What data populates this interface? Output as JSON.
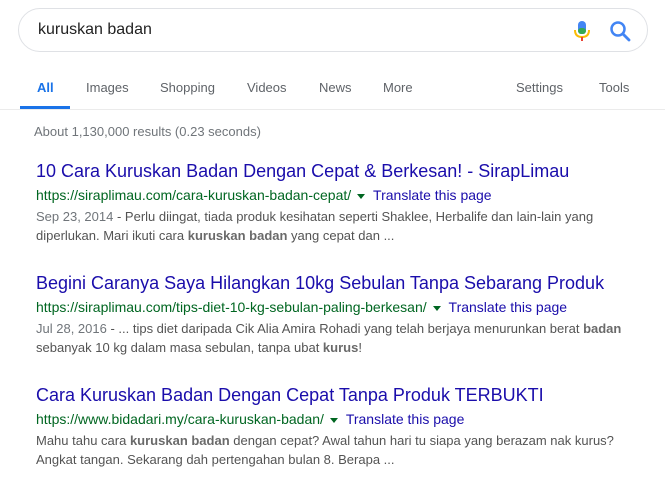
{
  "search": {
    "query": "kuruskan badan"
  },
  "tabs": [
    {
      "label": "All"
    },
    {
      "label": "Images"
    },
    {
      "label": "Shopping"
    },
    {
      "label": "Videos"
    },
    {
      "label": "News"
    },
    {
      "label": "More"
    },
    {
      "label": "Settings"
    },
    {
      "label": "Tools"
    }
  ],
  "stats": "About 1,130,000 results (0.23 seconds)",
  "results": [
    {
      "title": "10 Cara Kuruskan Badan Dengan Cepat & Berkesan! - SirapLimau",
      "url": "https://siraplimau.com/cara-kuruskan-badan-cepat/",
      "translate": "Translate this page",
      "date": "Sep 23, 2014",
      "snippet_a": " - Perlu diingat, tiada produk kesihatan seperti Shaklee, Herbalife dan lain-lain yang diperlukan. Mari ikuti cara ",
      "snippet_b": "kuruskan badan",
      "snippet_c": " yang cepat dan ..."
    },
    {
      "title": "Begini Caranya Saya Hilangkan 10kg Sebulan Tanpa Sebarang Produk",
      "url": "https://siraplimau.com/tips-diet-10-kg-sebulan-paling-berkesan/",
      "translate": "Translate this page",
      "date": "Jul 28, 2016",
      "snippet_a": " - ... tips diet daripada Cik Alia Amira Rohadi yang telah berjaya menurunkan berat ",
      "snippet_b": "badan",
      "snippet_c": " sebanyak 10 kg dalam masa sebulan, tanpa ubat ",
      "snippet_d": "kurus",
      "snippet_e": "!"
    },
    {
      "title": "Cara Kuruskan Badan Dengan Cepat Tanpa Produk TERBUKTI",
      "url": "https://www.bidadari.my/cara-kuruskan-badan/",
      "translate": "Translate this page",
      "snippet_a": "Mahu tahu cara ",
      "snippet_b": "kuruskan badan",
      "snippet_c": " dengan cepat? Awal tahun hari tu siapa yang berazam nak kurus? Angkat tangan. Sekarang dah pertengahan bulan 8. Berapa ..."
    }
  ]
}
